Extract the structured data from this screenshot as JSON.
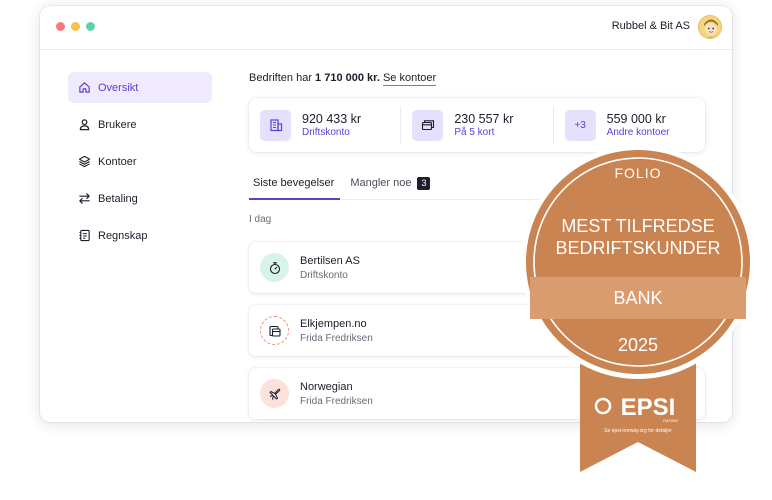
{
  "titlebar": {
    "company": "Rubbel & Bit AS"
  },
  "sidebar": {
    "items": [
      {
        "label": "Oversikt",
        "icon": "home-icon",
        "active": true
      },
      {
        "label": "Brukere",
        "icon": "user-icon"
      },
      {
        "label": "Kontoer",
        "icon": "layers-icon"
      },
      {
        "label": "Betaling",
        "icon": "transfer-icon"
      },
      {
        "label": "Regnskap",
        "icon": "ledger-icon"
      }
    ]
  },
  "summary": {
    "prefix": "Bedriften har",
    "amount": "1 710 000 kr.",
    "link": "Se kontoer"
  },
  "accounts": [
    {
      "amount": "920 433 kr",
      "label": "Driftskonto",
      "icon": "building-icon"
    },
    {
      "amount": "230 557 kr",
      "label": "På 5 kort",
      "icon": "card-icon"
    },
    {
      "amount": "559 000 kr",
      "label": "Andre kontoer",
      "icon_text": "+3"
    }
  ],
  "tabs": [
    {
      "label": "Siste bevegelser",
      "active": true
    },
    {
      "label": "Mangler noe",
      "badge": "3"
    }
  ],
  "day_label": "I dag",
  "transactions": [
    {
      "name": "Bertilsen AS",
      "sub": "Driftskonto",
      "icon": "stopwatch-icon",
      "color": "#d8f3ea"
    },
    {
      "name": "Elkjempen.no",
      "sub": "Frida Fredriksen",
      "icon": "cards-icon",
      "color": "#ffffff"
    },
    {
      "name": "Norwegian",
      "sub": "Frida Fredriksen",
      "icon": "plane-icon",
      "color": "#fde2dc"
    }
  ],
  "award": {
    "brand": "FOLIO",
    "line1": "MEST TILFREDSE",
    "line2": "BEDRIFTSKUNDER",
    "category": "BANK",
    "year": "2025",
    "ribbon_logo": "EPSI",
    "ribbon_sub": "RATING",
    "ribbon_note": "Se epsi-norway.org for detaljer",
    "color": "#c98451"
  }
}
